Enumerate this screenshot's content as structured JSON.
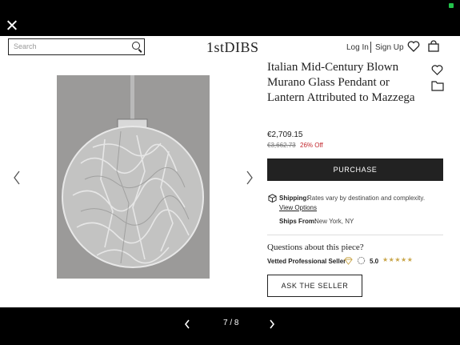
{
  "header": {
    "search_placeholder": "Search",
    "logo": "1stDIBS",
    "login": "Log In",
    "signup": "Sign Up",
    "heart_icon": "heart-icon",
    "bag_icon": "shopping-bag-icon"
  },
  "product": {
    "title": "Italian Mid-Century Blown Murano Glass Pendant or Lantern Attributed to Mazzega",
    "price": "€2,709.15",
    "old_price": "€3,662.73",
    "discount": "26% Off",
    "purchase_label": "PURCHASE",
    "shipping_label": "Shipping:",
    "shipping_text": "Rates vary by destination and complexity.",
    "view_options": "View Options",
    "ships_from_label": "Ships From:",
    "ships_from_value": "New York, NY",
    "questions": "Questions about this piece?",
    "seller_badge": "Vetted Professional Seller",
    "rating": "5.0",
    "stars": "★★★★★",
    "ask_label": "ASK THE SELLER"
  },
  "gallery": {
    "pager": "7 / 8"
  },
  "colors": {
    "accent": "#222222",
    "discount": "#c2272d",
    "star": "#c9a64a"
  }
}
